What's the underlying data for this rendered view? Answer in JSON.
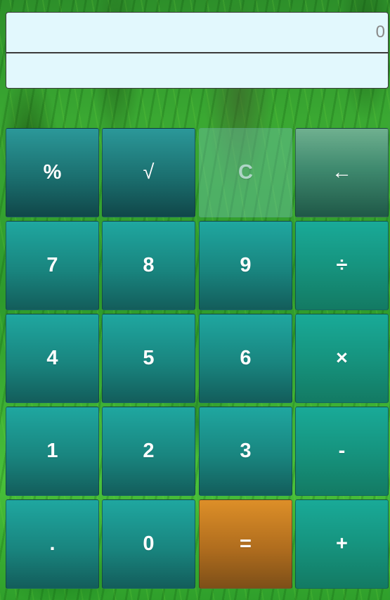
{
  "display": {
    "main_value": "0",
    "secondary_value": ""
  },
  "keys": {
    "percent": "%",
    "sqrt": "√",
    "clear": "C",
    "backspace": "←",
    "seven": "7",
    "eight": "8",
    "nine": "9",
    "divide": "÷",
    "four": "4",
    "five": "5",
    "six": "6",
    "multiply": "×",
    "one": "1",
    "two": "2",
    "three": "3",
    "minus": "-",
    "decimal": ".",
    "zero": "0",
    "equals": "=",
    "plus": "+"
  },
  "colors": {
    "display_bg": "#e2f8fd",
    "number_key": "#19857f",
    "operator_key": "#16947f",
    "equals_key": "#b06d1e",
    "background": "#2e9a2c"
  }
}
